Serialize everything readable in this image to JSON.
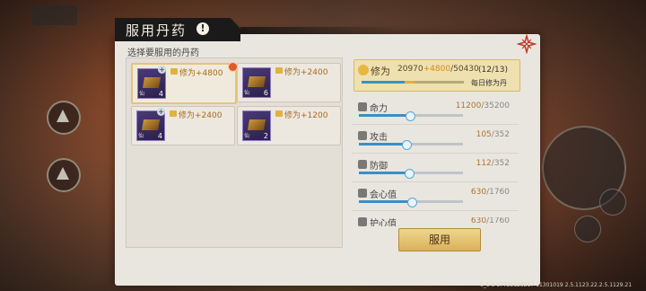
{
  "title": "服用丹药",
  "title_icon": "!",
  "subtitle": "选择要服用的丹药",
  "items": [
    {
      "count": "4",
      "label": "仙",
      "effect": "修为+4800",
      "selected": true,
      "has_dot": true,
      "has_plus": true
    },
    {
      "count": "6",
      "label": "仙",
      "effect": "修为+2400",
      "selected": false,
      "has_dot": false,
      "has_plus": false
    },
    {
      "count": "4",
      "label": "仙",
      "effect": "修为+2400",
      "selected": false,
      "has_dot": false,
      "has_plus": true
    },
    {
      "count": "2",
      "label": "仙",
      "effect": "修为+1200",
      "selected": false,
      "has_dot": false,
      "has_plus": false
    }
  ],
  "xiuwei": {
    "name": "修为",
    "current": "20970",
    "add": "+4800",
    "max": "/50430",
    "count": "(12/13)",
    "daily_label": "每日修为丹",
    "fill_pct": 0.42,
    "add_pct": 0.1
  },
  "stats": [
    {
      "name": "命力",
      "cur": "11200",
      "max": "/35200",
      "pct": 0.48
    },
    {
      "name": "攻击",
      "cur": "105",
      "max": "/352",
      "pct": 0.45
    },
    {
      "name": "防御",
      "cur": "112",
      "max": "/352",
      "pct": 0.47
    },
    {
      "name": "会心值",
      "cur": "630",
      "max": "/1760",
      "pct": 0.5
    },
    {
      "name": "护心值",
      "cur": "630",
      "max": "/1760",
      "pct": 0.5
    }
  ],
  "use_button": "服用",
  "footer": "1_1 1 17725129217 11301019 2.5.1123.22.2.5.1129.21",
  "colors": {
    "accent": "#e0b03a",
    "bar": "#3a8fc6"
  }
}
